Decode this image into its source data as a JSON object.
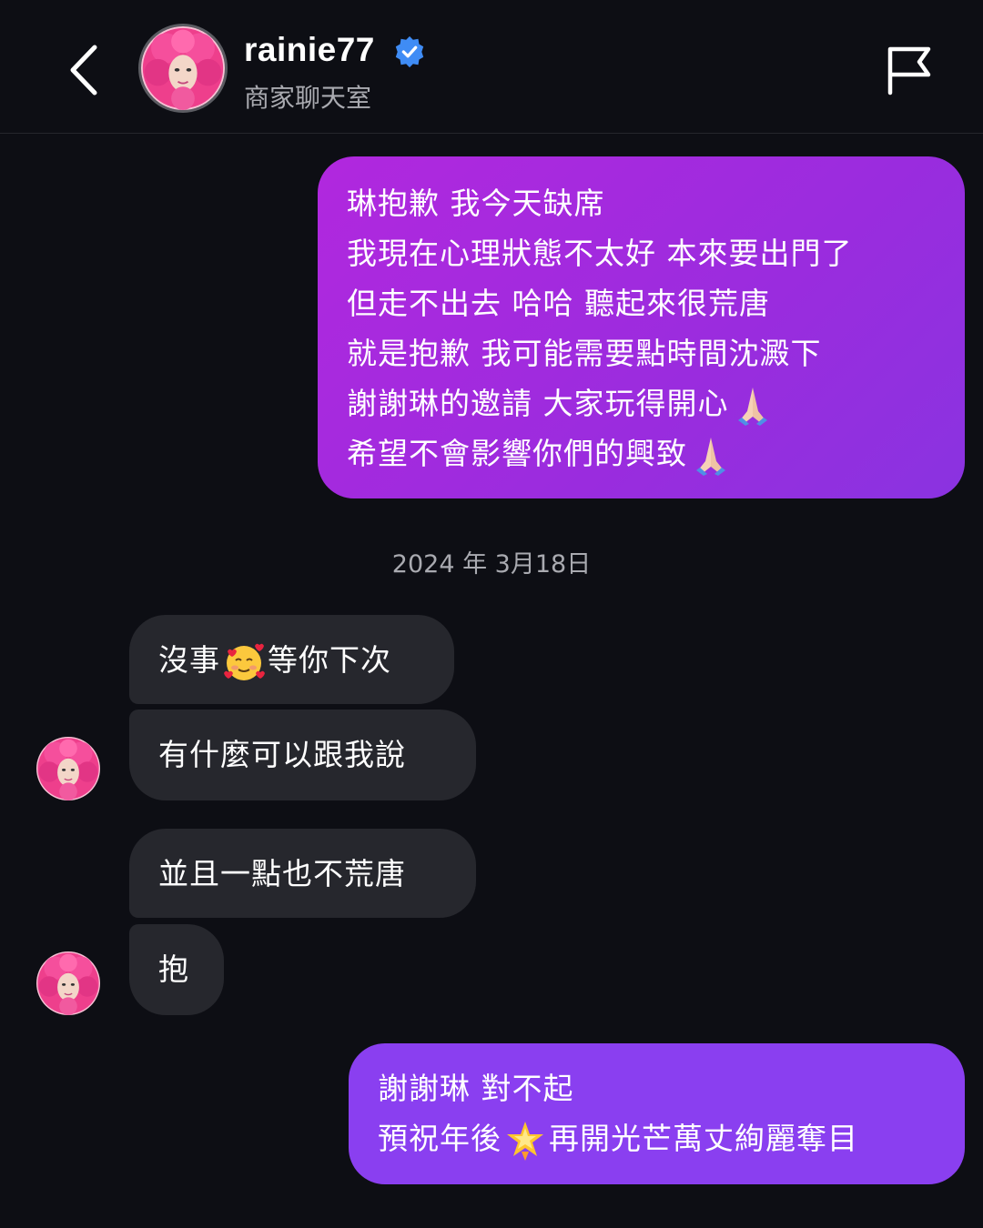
{
  "header": {
    "username": "rainie77",
    "subtitle": "商家聊天室",
    "verified_color": "#3f8cf5"
  },
  "colors": {
    "background": "#0d0e14",
    "sent_bubble": "#a92ddf",
    "sent_bubble_last": "#8a3ff0",
    "received_bubble": "#26272d"
  },
  "icons": {
    "back": "chevron-left-icon",
    "flag": "flag-icon",
    "verified": "verified-badge-icon"
  },
  "messages": {
    "sent1": {
      "lines": [
        "琳抱歉 我今天缺席",
        "我現在心理狀態不太好 本來要出門了",
        "但走不出去 哈哈 聽起來很荒唐",
        "就是抱歉 我可能需要點時間沈澱下",
        "謝謝琳的邀請 大家玩得開心",
        "希望不會影響你們的興致"
      ]
    },
    "date_separator": "2024 年 3月18日",
    "recv1": {
      "before": "沒事",
      "after": "等你下次"
    },
    "recv2": {
      "text": "有什麼可以跟我說"
    },
    "recv3": {
      "text": "並且一點也不荒唐"
    },
    "recv4": {
      "text": "抱"
    },
    "sent2": {
      "line1": "謝謝琳 對不起",
      "line2_before": "預祝年後",
      "line2_after": "再開光芒萬丈絢麗奪目"
    }
  }
}
